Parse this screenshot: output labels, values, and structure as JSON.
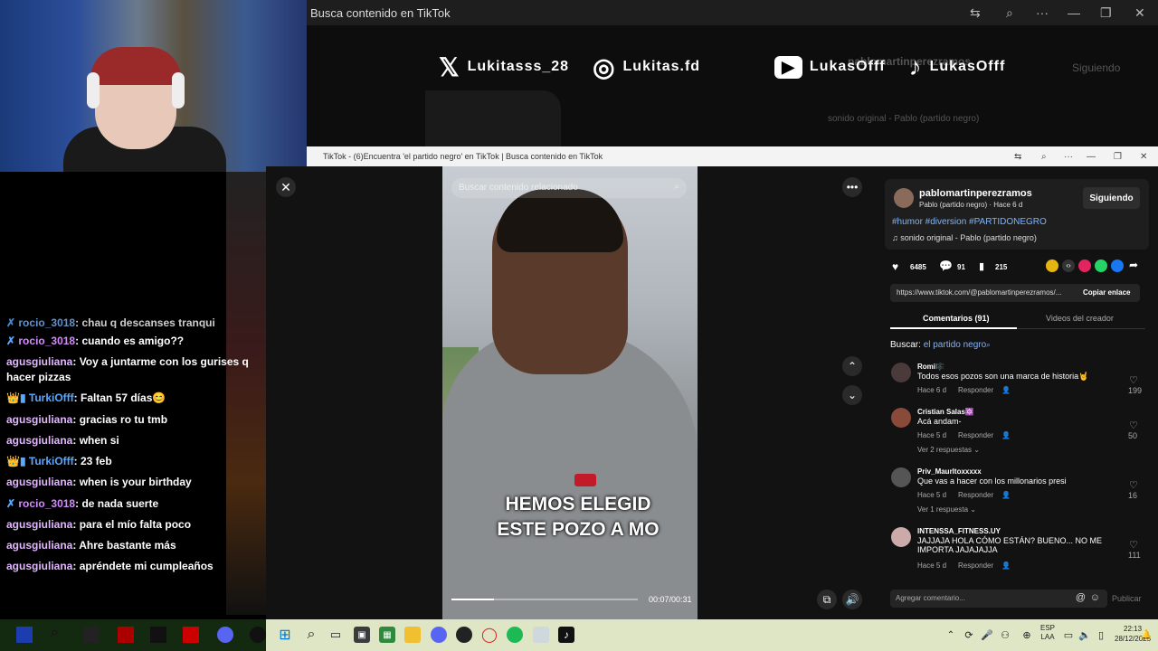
{
  "top_window": {
    "title": "Busca contenido en TikTok",
    "following": "Siguiendo",
    "ghost_user": "pablomartinperezramos",
    "ghost_sound": "sonido original - Pablo (partido negro)"
  },
  "socials": [
    {
      "icon": "x-logo-icon",
      "glyph": "𝕏",
      "handle": "Lukitasss_28"
    },
    {
      "icon": "instagram-icon",
      "glyph": "◎",
      "handle": "Lukitas.fd"
    },
    {
      "icon": "youtube-icon",
      "glyph": "▶",
      "handle": "LukasOfff"
    },
    {
      "icon": "tiktok-icon",
      "glyph": "♪",
      "handle": "LukasOfff"
    }
  ],
  "chat": [
    {
      "user": "rocio_3018",
      "text": "chau q descanses tranqui",
      "badge": "✗",
      "user_color": "#7ab8ff"
    },
    {
      "user": "rocio_3018",
      "text": "cuando es amigo??",
      "badge": "✗",
      "user_color": "#d58bff"
    },
    {
      "user": "agusgiuliana",
      "text": "Voy a juntarme con los gurises q hacer pizzas",
      "badge": "",
      "user_color": "#e2b8ff"
    },
    {
      "user": "TurkiOfff",
      "text": "Faltan 57 días😊",
      "badge": "👑▮",
      "user_color": "#5aa8ff"
    },
    {
      "user": "agusgiuliana",
      "text": "gracias ro tu tmb",
      "badge": "",
      "user_color": "#e2b8ff"
    },
    {
      "user": "agusgiuliana",
      "text": "when si",
      "badge": "",
      "user_color": "#e2b8ff"
    },
    {
      "user": "TurkiOfff",
      "text": "23 feb",
      "badge": "👑▮",
      "user_color": "#5aa8ff"
    },
    {
      "user": "agusgiuliana",
      "text": "when is your birthday",
      "badge": "",
      "user_color": "#e2b8ff"
    },
    {
      "user": "rocio_3018",
      "text": "de nada suerte",
      "badge": "✗",
      "user_color": "#d58bff"
    },
    {
      "user": "agusgiuliana",
      "text": "para el mío falta poco",
      "badge": "",
      "user_color": "#e2b8ff"
    },
    {
      "user": "agusgiuliana",
      "text": "Ahre bastante más",
      "badge": "",
      "user_color": "#e2b8ff"
    },
    {
      "user": "agusgiuliana",
      "text": "apréndete mi cumpleaños",
      "badge": "",
      "user_color": "#e2b8ff"
    }
  ],
  "tiktok_window": {
    "title": "TikTok - (6)Encuentra 'el partido negro' en TikTok | Busca contenido en TikTok"
  },
  "video": {
    "search_placeholder": "Buscar contenido relacionado",
    "caption_line1": "HEMOS ELEGID",
    "caption_line2": "ESTE POZO A MO",
    "time": "00:07/00:31",
    "progress": 0.23
  },
  "post": {
    "username": "pablomartinperezramos",
    "subtitle": "Pablo (partido negro) · Hace 6 d",
    "follow": "Siguiendo",
    "hashtags": "#humor #diversion #PARTIDONEGRO",
    "sound": "sonido original - Pablo (partido negro)",
    "likes": "6485",
    "comments": "91",
    "saves": "215",
    "link": "https://www.tiktok.com/@pablomartinperezramos/...",
    "copy_link": "Copiar enlace"
  },
  "tabs": {
    "comments": "Comentarios (91)",
    "creator": "Videos del creador"
  },
  "search": {
    "label": "Buscar:",
    "term": "el partido negro"
  },
  "comments": [
    {
      "name": "Romi🎼",
      "text": "Todos esos pozos son una marca de historia🤘",
      "time": "Hace 6 d",
      "reply": "Responder",
      "likes": "199",
      "more": ""
    },
    {
      "name": "Cristian Salas🔯",
      "text": "Acá andam-",
      "time": "Hace 5 d",
      "reply": "Responder",
      "likes": "50",
      "more": "Ver 2 respuestas ⌄"
    },
    {
      "name": "Priv_Maurltoxxxxx",
      "text": "Que vas a hacer con los millonarios presi",
      "time": "Hace 5 d",
      "reply": "Responder",
      "likes": "16",
      "more": "Ver 1 respuesta ⌄"
    },
    {
      "name": "INTENSSA_FITNESS.UY",
      "text": "JAJJAJA HOLA CÓMO ESTÁN? BUENO... NO ME IMPORTA JAJAJAJJA",
      "time": "Hace 5 d",
      "reply": "Responder",
      "likes": "111",
      "more": ""
    }
  ],
  "comment_input": {
    "placeholder": "Agregar comentario...",
    "publish": "Publicar"
  },
  "taskbar": {
    "lang": "ESP\nLAA",
    "time": "22:13",
    "date": "28/12/2025"
  }
}
